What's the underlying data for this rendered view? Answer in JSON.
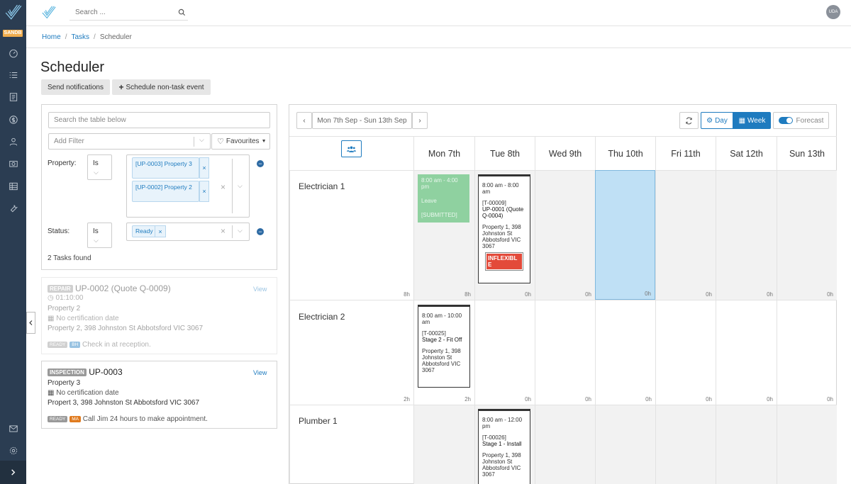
{
  "app": {
    "env_badge": "SANDB"
  },
  "search": {
    "placeholder": "Search ..."
  },
  "user": {
    "initials": "UDA"
  },
  "breadcrumb": {
    "home": "Home",
    "tasks": "Tasks",
    "current": "Scheduler",
    "sep": "/"
  },
  "page": {
    "title": "Scheduler"
  },
  "actions": {
    "send_notifications": "Send notifications",
    "schedule_event": "Schedule non-task event"
  },
  "filters": {
    "table_search_placeholder": "Search the table below",
    "add_filter_placeholder": "Add Filter",
    "favourites": "Favourites",
    "property_label": "Property:",
    "property_op": "Is",
    "property_tags": [
      "[UP-0003] Property 3",
      "[UP-0002] Property 2"
    ],
    "status_label": "Status:",
    "status_op": "Is",
    "status_tags": [
      "Ready"
    ],
    "found": "2 Tasks found"
  },
  "tasks": [
    {
      "type": "REPAIR",
      "title": "UP-0002 (Quote Q-0009)",
      "view": "View",
      "duration": "01:10:00",
      "property": "Property 2",
      "cert": "No certification date",
      "address": "Property 2, 398 Johnston St Abbotsford VIC 3067",
      "status": "READY",
      "initials": "BH",
      "note": "Check in at reception."
    },
    {
      "type": "INSPECTION",
      "title": "UP-0003",
      "view": "View",
      "property": "Property 3",
      "cert": "No certification date",
      "address": "Propert 3, 398 Johnston St Abbotsford VIC 3067",
      "status": "READY",
      "initials": "MA",
      "note": "Call Jim 24 hours to make appointment."
    }
  ],
  "calendar": {
    "range": "Mon 7th Sep - Sun 13th Sep",
    "day_label": "Day",
    "week_label": "Week",
    "forecast_label": "Forecast",
    "days": [
      "Mon 7th",
      "Tue 8th",
      "Wed 9th",
      "Thu 10th",
      "Fri 11th",
      "Sat 12th",
      "Sun 13th"
    ],
    "rows": [
      {
        "name": "Electrician 1",
        "hours": [
          "8h",
          "8h",
          "0h",
          "0h",
          "0h",
          "0h",
          "0h",
          "0h"
        ]
      },
      {
        "name": "Electrician 2",
        "hours": [
          "2h",
          "2h",
          "0h",
          "0h",
          "0h",
          "0h",
          "0h",
          "0h"
        ]
      },
      {
        "name": "Plumber 1",
        "hours": []
      }
    ],
    "events": {
      "leave": {
        "time": "8:00 am - 4:00 pm",
        "type": "Leave",
        "status": "[SUBMITTED]"
      },
      "e1": {
        "time": "8:00 am - 8:00 am",
        "code": "[T-00009]",
        "title": "UP-0001 (Quote Q-0004)",
        "address": "Property 1, 398 Johnston St Abbotsford VIC 3067",
        "flag": "INFLEXIBLE"
      },
      "e2": {
        "time": "8:00 am - 10:00 am",
        "code": "[T-00025]",
        "title": "Stage 2 - Fit Off",
        "address": "Property 1, 398 Johnston St Abbotsford VIC 3067"
      },
      "e3": {
        "time": "8:00 am - 12:00 pm",
        "code": "[T-00026]",
        "title": "Stage 1 - Install",
        "address": "Property 1, 398 Johnston St Abbotsford VIC 3067"
      }
    }
  },
  "colors": {
    "sidebar": "#2b3d52",
    "accent": "#1e7bbf",
    "leave": "#8fd1a0",
    "selected_day": "#bfe0f5",
    "flag": "#e34a3a"
  }
}
